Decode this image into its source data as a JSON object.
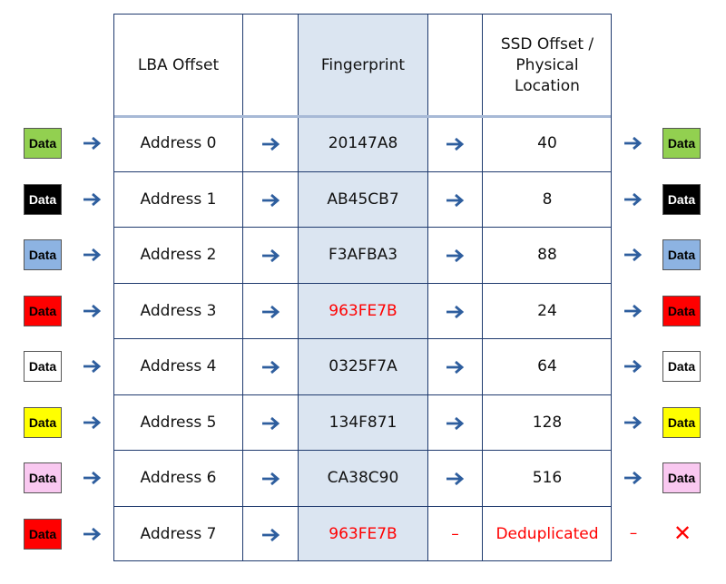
{
  "header": {
    "lba": "LBA Offset",
    "fingerprint": "Fingerprint",
    "ssd": "SSD Offset / Physical Location"
  },
  "rows": [
    {
      "label": "Data",
      "color": "#92d050",
      "text_color": "#000000",
      "address": "Address 0",
      "fingerprint": "20147A8",
      "location": "40",
      "duplicate": false
    },
    {
      "label": "Data",
      "color": "#000000",
      "text_color": "#ffffff",
      "address": "Address 1",
      "fingerprint": "AB45CB7",
      "location": "8",
      "duplicate": false
    },
    {
      "label": "Data",
      "color": "#8db3e2",
      "text_color": "#000000",
      "address": "Address 2",
      "fingerprint": "F3AFBA3",
      "location": "88",
      "duplicate": false
    },
    {
      "label": "Data",
      "color": "#ff0000",
      "text_color": "#000000",
      "address": "Address 3",
      "fingerprint": "963FE7B",
      "location": "24",
      "duplicate": true
    },
    {
      "label": "Data",
      "color": "#ffffff",
      "text_color": "#000000",
      "address": "Address 4",
      "fingerprint": "0325F7A",
      "location": "64",
      "duplicate": false
    },
    {
      "label": "Data",
      "color": "#ffff00",
      "text_color": "#000000",
      "address": "Address 5",
      "fingerprint": "134F871",
      "location": "128",
      "duplicate": false
    },
    {
      "label": "Data",
      "color": "#f9c8f0",
      "text_color": "#000000",
      "address": "Address 6",
      "fingerprint": "CA38C90",
      "location": "516",
      "duplicate": false
    },
    {
      "label": "Data",
      "color": "#ff0000",
      "text_color": "#000000",
      "address": "Address 7",
      "fingerprint": "963FE7B",
      "location": "Deduplicated",
      "duplicate": true,
      "dedup": true,
      "dash": "–",
      "cross": "✕"
    }
  ],
  "colors": {
    "arrow": "#2e5e9e",
    "border": "#1f3a6e",
    "fingerprint_bg": "#dbe5f1",
    "highlight": "#ff0000"
  }
}
